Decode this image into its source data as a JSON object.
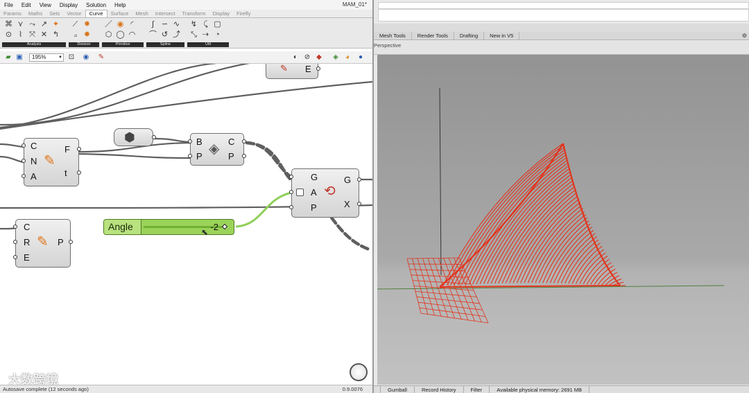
{
  "grasshopper": {
    "menu": [
      "File",
      "Edit",
      "View",
      "Display",
      "Solution",
      "Help"
    ],
    "doc_title": "MAM_01*",
    "tabs": [
      "Params",
      "Maths",
      "Sets",
      "Vector",
      "Curve",
      "Surface",
      "Mesh",
      "Intersect",
      "Transform",
      "Display",
      "Firefly"
    ],
    "active_tab": "Curve",
    "ribbon_groups": [
      "Analysis",
      "Division",
      "Primitive",
      "Spline",
      "Util"
    ],
    "zoom": "195%",
    "components": {
      "curve_closest": {
        "inputs": [
          "C",
          "N",
          "A"
        ],
        "outputs": [
          "F",
          "t"
        ]
      },
      "brep": {
        "inputs": [
          "B",
          "P"
        ],
        "outputs": [
          "C",
          "P"
        ]
      },
      "rotate": {
        "inputs": [
          "G",
          "A",
          "P"
        ],
        "outputs": [
          "G",
          "X"
        ]
      },
      "circle_point": {
        "inputs": [
          "C",
          "R",
          "E"
        ],
        "outputs": [
          "P"
        ]
      },
      "top_partial": {
        "outputs": [
          "E"
        ]
      }
    },
    "slider": {
      "name": "Angle",
      "value": "-2"
    },
    "status": "Autosave complete (12 seconds ago)",
    "version": "0.9.0076",
    "watermark": "大数跨境"
  },
  "rhino": {
    "tabs": [
      "Mesh Tools",
      "Render Tools",
      "Drafting",
      "New in V5"
    ],
    "viewport_title": "Perspective",
    "status": [
      "Gumball",
      "Record History",
      "Filter",
      "Available physical memory: 2691 MB"
    ]
  },
  "colors": {
    "slider_green": "#9bd35a",
    "wire": "#5f5f5f",
    "selected_wire": "#8fcf5a",
    "geometry_red": "#e2341c",
    "viewport_gray": "#a9a9a9"
  }
}
